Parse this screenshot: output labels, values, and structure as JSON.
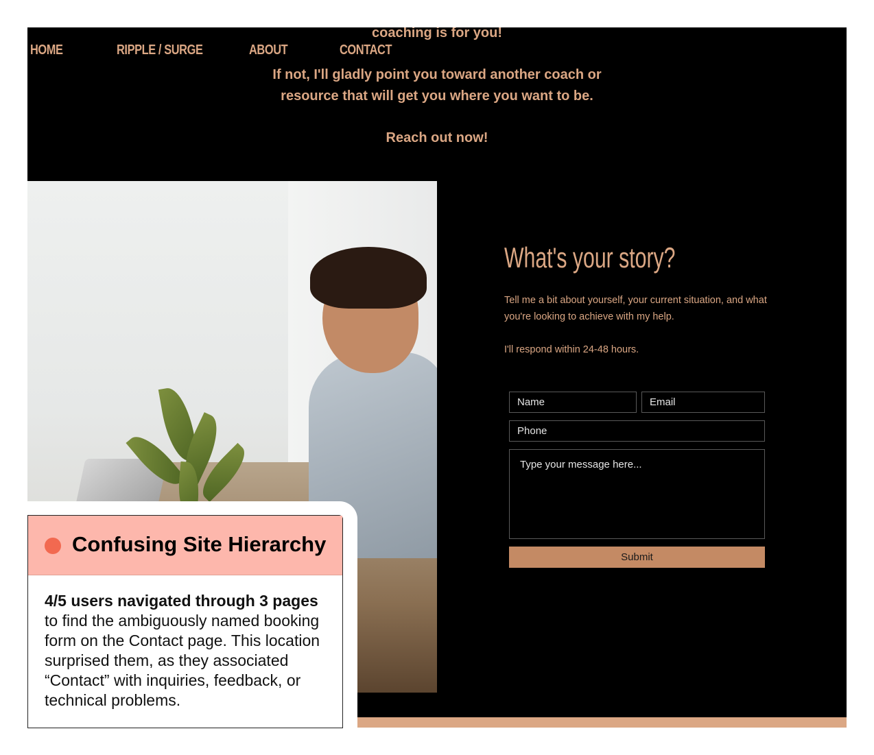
{
  "nav": {
    "items": [
      "HOME",
      "RIPPLE / SURGE",
      "ABOUT",
      "CONTACT"
    ]
  },
  "intro": {
    "line0": "coaching is for you!",
    "line1": "If not, I'll gladly point you toward another coach or",
    "line2": "resource that will get you where you want to be.",
    "cta": "Reach out now!"
  },
  "form_section": {
    "title": "What's your story?",
    "description": "Tell me a bit about yourself, your current situation, and what you're looking to achieve with my help.",
    "response_note": "I'll respond within 24-48 hours.",
    "name_placeholder": "Name",
    "email_placeholder": "Email",
    "phone_placeholder": "Phone",
    "message_placeholder": "Type your message here...",
    "submit_label": "Submit"
  },
  "callout": {
    "title": "Confusing Site Hierarchy",
    "highlight": "4/5 users navigated through 3 pages",
    "body": "to find the ambiguously named booking form on the Contact page. This location surprised them, as they associated “Contact” with inquiries, feedback, or technical problems."
  },
  "colors": {
    "accent": "#dba784",
    "button": "#c48a64",
    "callout_header": "#fdb7ac",
    "callout_dot": "#f26950",
    "site_bg": "#000000"
  }
}
